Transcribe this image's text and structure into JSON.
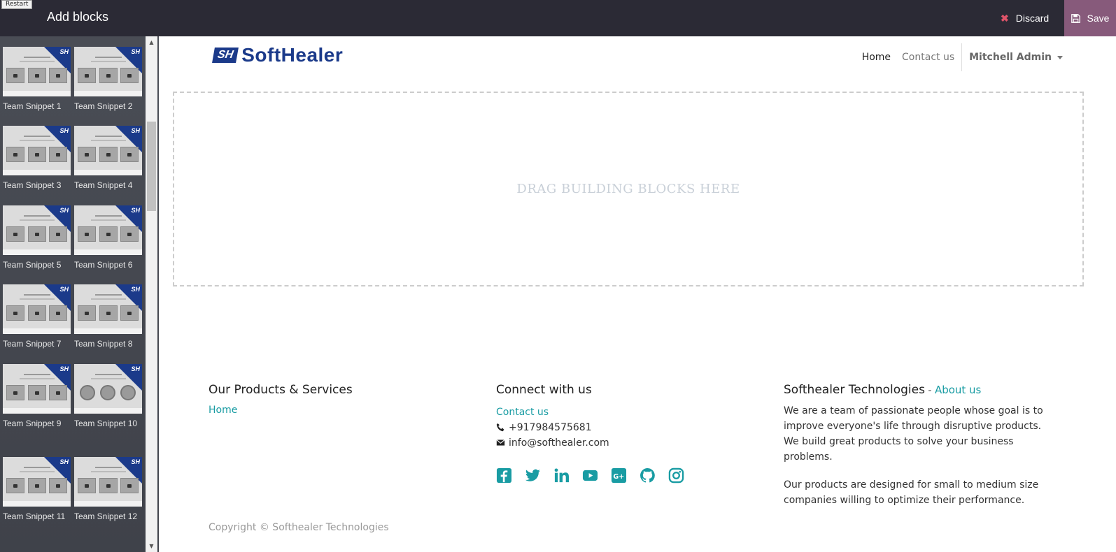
{
  "topbar": {
    "restart_label": "Restart",
    "title": "Add blocks",
    "discard_label": "Discard",
    "save_label": "Save"
  },
  "snippets": [
    {
      "label": "Team Snippet 1",
      "style": "cards"
    },
    {
      "label": "Team Snippet 2",
      "style": "cards"
    },
    {
      "label": "Team Snippet 3",
      "style": "cards"
    },
    {
      "label": "Team Snippet 4",
      "style": "cards"
    },
    {
      "label": "Team Snippet 5",
      "style": "cards"
    },
    {
      "label": "Team Snippet 6",
      "style": "cards"
    },
    {
      "label": "Team Snippet 7",
      "style": "cards"
    },
    {
      "label": "Team Snippet 8",
      "style": "cards"
    },
    {
      "label": "Team Snippet 9",
      "style": "cards"
    },
    {
      "label": "Team Snippet 10",
      "style": "circles"
    },
    {
      "label": "Team Snippet 11",
      "style": "cards"
    },
    {
      "label": "Team Snippet 12",
      "style": "cards"
    }
  ],
  "thumb_badge": "SH",
  "site": {
    "logo_mark": "SH",
    "logo_text": "SoftHealer",
    "nav": {
      "home": "Home",
      "contact": "Contact us",
      "user": "Mitchell Admin"
    },
    "dropzone_text": "DRAG BUILDING BLOCKS HERE",
    "footer": {
      "col1_title": "Our Products & Services",
      "col1_link": "Home",
      "col2_title": "Connect with us",
      "col2_link": "Contact us",
      "phone": "+917984575681",
      "email": "info@softhealer.com",
      "col3_title": "Softhealer Technologies",
      "col3_sep": " - ",
      "col3_link": "About us",
      "para1": "We are a team of passionate people whose goal is to improve everyone's life through disruptive products. We build great products to solve your business problems.",
      "para2": "Our products are designed for small to medium size companies willing to optimize their performance.",
      "copyright": "Copyright © Softhealer Technologies"
    },
    "social_icons": [
      "facebook-icon",
      "twitter-icon",
      "linkedin-icon",
      "youtube-icon",
      "google-plus-icon",
      "github-icon",
      "instagram-icon"
    ]
  },
  "colors": {
    "topbar_bg": "#2b2a35",
    "save_bg": "#875a7b",
    "brand_blue": "#1b3a8a",
    "link_teal": "#199ca3",
    "discard_x": "#e0546a"
  }
}
